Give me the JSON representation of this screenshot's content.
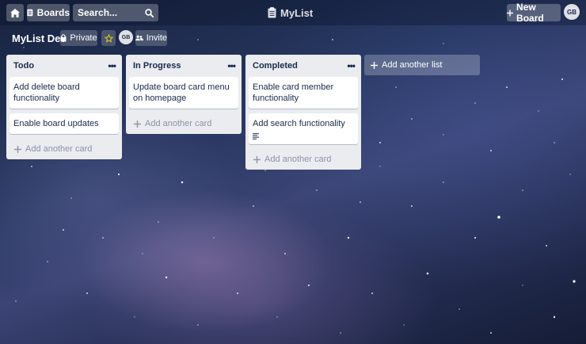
{
  "header": {
    "boards_label": "Boards",
    "search_placeholder": "Search...",
    "app_title": "MyList",
    "new_board_label": "New Board",
    "user_initials": "GB"
  },
  "board": {
    "title": "MyList Dev",
    "visibility_label": "Private",
    "member_initials": "GB",
    "invite_label": "Invite"
  },
  "lists": [
    {
      "title": "Todo",
      "cards": [
        "Add delete board functionality",
        "Enable board updates"
      ],
      "add_card_label": "Add another card"
    },
    {
      "title": "In Progress",
      "cards": [
        "Update board card menu on homepage"
      ],
      "add_card_label": "Add another card"
    },
    {
      "title": "Completed",
      "cards": [
        "Enable card member functionality",
        "Add search functionality"
      ],
      "add_card_label": "Add another card"
    }
  ],
  "add_list_label": "Add another list",
  "icons": [
    "home-icon",
    "board-icon",
    "search-icon",
    "clipboard-icon",
    "plus-icon",
    "lock-icon",
    "star-icon",
    "people-icon",
    "more-icon",
    "description-icon"
  ],
  "colors": {
    "list_bg": "#ebecf0",
    "card_bg": "#ffffff",
    "text": "#172b4d",
    "muted": "#8a93a6"
  }
}
